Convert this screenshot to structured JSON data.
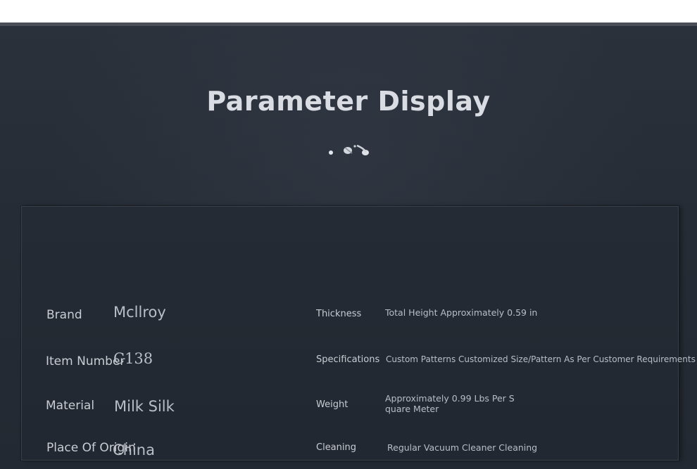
{
  "header": {
    "title": "Parameter Display"
  },
  "parameters": {
    "left": [
      {
        "label": "Brand",
        "value": "Mcllroy"
      },
      {
        "label": "Item Number",
        "value": "C138"
      },
      {
        "label": "Material",
        "value": "Milk Silk"
      },
      {
        "label": "Place Of Origin",
        "value": "China"
      }
    ],
    "right": [
      {
        "label": "Thickness",
        "value": "Total Height Approximately 0.59 in"
      },
      {
        "label": "Specifications",
        "value": "Custom Patterns Customized Size/Pattern As Per Customer Requirements"
      },
      {
        "label": "Weight",
        "value_line1": "Approximately 0.99 Lbs Per S",
        "value_line2": "quare Meter"
      },
      {
        "label": "Cleaning",
        "value": "Regular Vacuum Cleaner Cleaning"
      }
    ]
  },
  "colors": {
    "background": "#262c35",
    "title": "#d9dde3",
    "text": "#c9cdd3"
  },
  "icons": {
    "ornament": "decorative-scroll-icon"
  }
}
